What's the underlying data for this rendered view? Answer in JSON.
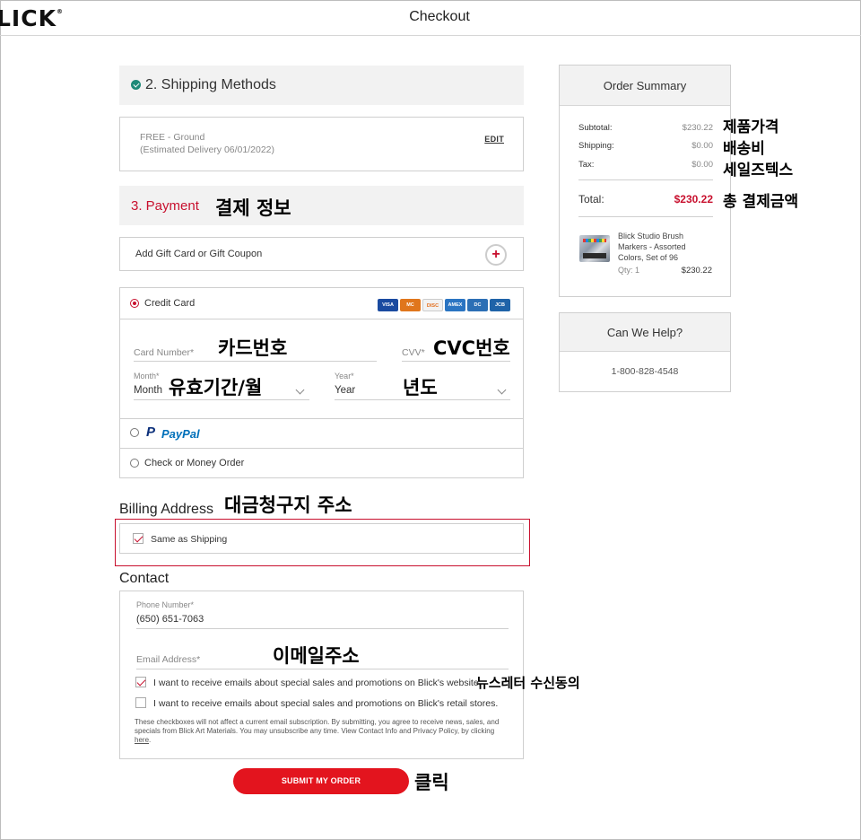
{
  "header": {
    "logo": "LICK",
    "logo_mark": "®",
    "title": "Checkout"
  },
  "shipping": {
    "heading": "2. Shipping Methods",
    "method": "FREE - Ground",
    "estimate": "(Estimated Delivery 06/01/2022)",
    "edit_label": "EDIT"
  },
  "payment": {
    "heading": "3. Payment",
    "gift_label": "Add Gift Card or Gift Coupon",
    "gift_plus": "+",
    "credit_card_label": "Credit Card",
    "card_brands": [
      "VISA",
      "MC",
      "DISC",
      "AMEX",
      "DC",
      "JCB"
    ],
    "card_number_placeholder": "Card Number*",
    "cvv_placeholder": "CVV*",
    "month_label": "Month*",
    "month_value": "Month",
    "year_label": "Year*",
    "year_value": "Year",
    "paypal_p": "P",
    "paypal_label": "PayPal",
    "check_label": "Check or Money Order"
  },
  "billing": {
    "title": "Billing Address",
    "same_label": "Same as Shipping"
  },
  "contact": {
    "title": "Contact",
    "phone_label": "Phone Number*",
    "phone_value": "(650) 651-7063",
    "email_placeholder": "Email Address*",
    "opt_website": "I want to receive emails about special sales and promotions on Blick's website.",
    "opt_stores": "I want to receive emails about special sales and promotions on Blick's retail stores.",
    "fine_print": "These checkboxes will not affect a current email subscription. By submitting, you agree to receive news, sales, and specials from Blick Art Materials. You may unsubscribe any time. View Contact Info and Privacy Policy, by clicking",
    "fine_link": "here",
    "fine_end": "."
  },
  "submit_label": "SUBMIT MY ORDER",
  "summary": {
    "title": "Order Summary",
    "subtotal_label": "Subtotal:",
    "subtotal": "$230.22",
    "shipping_label": "Shipping:",
    "shipping": "$0.00",
    "tax_label": "Tax:",
    "tax": "$0.00",
    "total_label": "Total:",
    "total": "$230.22",
    "product_name": "Blick Studio Brush Markers - Assorted Colors, Set of 96",
    "qty": "Qty: 1",
    "product_price": "$230.22"
  },
  "help": {
    "title": "Can We Help?",
    "phone": "1-800-828-4548"
  },
  "annotations": {
    "payment_info": "결제 정보",
    "card_number": "카드번호",
    "cvc": "CVC번호",
    "expiry_month": "유효기간/월",
    "year": "년도",
    "billing_address": "대금청구지 주소",
    "email": "이메일주소",
    "newsletter": "뉴스레터 수신동의",
    "click": "클릭",
    "product_price": "제품가격",
    "shipping_fee": "배송비",
    "sales_tax": "세일즈텍스",
    "total_amount": "총 결제금액"
  },
  "colors": {
    "accent_red": "#c8102e",
    "button_red": "#e3141e",
    "check_green": "#1d8a78"
  }
}
